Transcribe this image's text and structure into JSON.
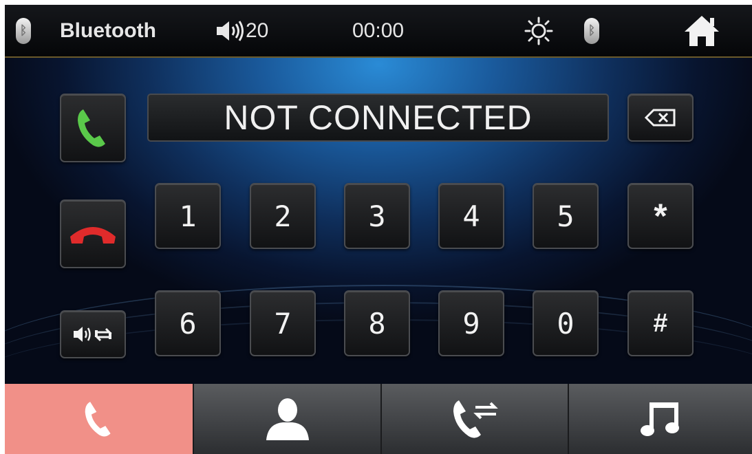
{
  "status_bar": {
    "source_label": "Bluetooth",
    "volume_value": "20",
    "clock": "00:00"
  },
  "dialer": {
    "display_text": "NOT CONNECTED",
    "row1_keys": [
      "1",
      "2",
      "3",
      "4",
      "5",
      "*"
    ],
    "row2_keys": [
      "6",
      "7",
      "8",
      "9",
      "0",
      "#"
    ]
  },
  "bottom_tabs": [
    {
      "icon": "phone-icon",
      "active": true
    },
    {
      "icon": "contacts-icon",
      "active": false
    },
    {
      "icon": "call-transfer-icon",
      "active": false
    },
    {
      "icon": "music-note-icon",
      "active": false
    }
  ],
  "colors": {
    "call_green": "#5ac94a",
    "hangup_red": "#e02b2b",
    "active_tab": "#f19088"
  }
}
